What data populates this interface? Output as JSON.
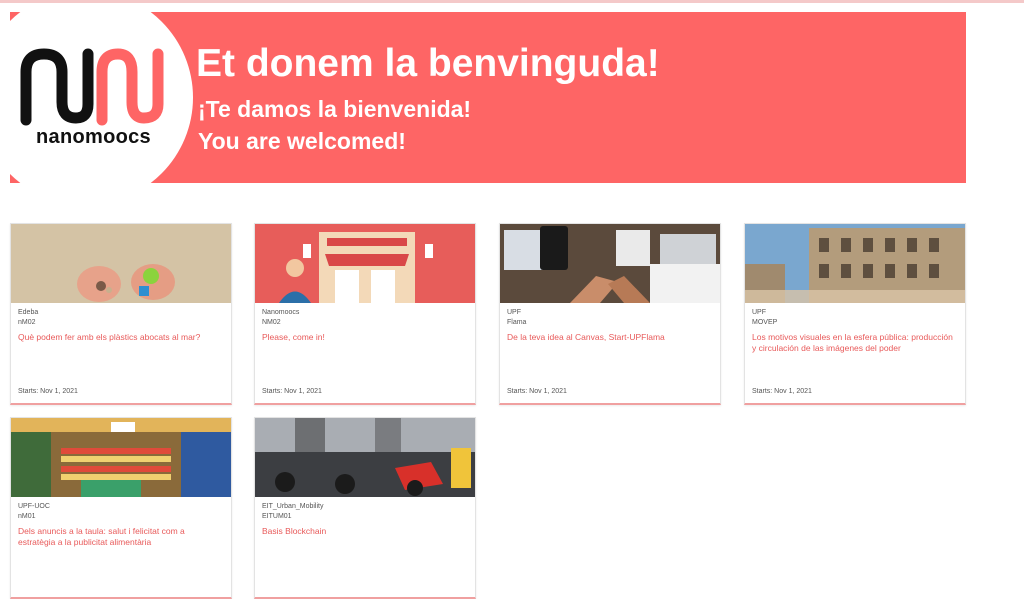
{
  "hero": {
    "logo_text": "nanomoocs",
    "title": "Et donem la benvinguda!",
    "subtitle_es": "¡Te damos la bienvenida!",
    "subtitle_en": "You are welcomed!",
    "background": "#fe6565"
  },
  "courses": [
    {
      "org": "Edeba",
      "code": "nM02",
      "title": "Què podem fer amb els plàstics abocats al mar?",
      "starts": "Starts: Nov 1, 2021"
    },
    {
      "org": "Nanomoocs",
      "code": "NM02",
      "title": "Please, come in!",
      "starts": "Starts: Nov 1, 2021"
    },
    {
      "org": "UPF",
      "code": "Flama",
      "title": "De la teva idea al Canvas, Start-UPFlama",
      "starts": "Starts: Nov 1, 2021"
    },
    {
      "org": "UPF",
      "code": "MOVEP",
      "title": "Los motivos visuales en la esfera pública: producción y circulación de las imágenes del poder",
      "starts": "Starts: Nov 1, 2021"
    },
    {
      "org": "UPF-UOC",
      "code": "nM01",
      "title": "Dels anuncis a la taula: salut i felicitat com a estratègia a la publicitat alimentària",
      "starts": ""
    },
    {
      "org": "EIT_Urban_Mobility",
      "code": "EITUM01",
      "title": "Basis Blockchain",
      "starts": ""
    }
  ],
  "colors": {
    "accent": "#fe6565",
    "link": "#e85a5a"
  }
}
